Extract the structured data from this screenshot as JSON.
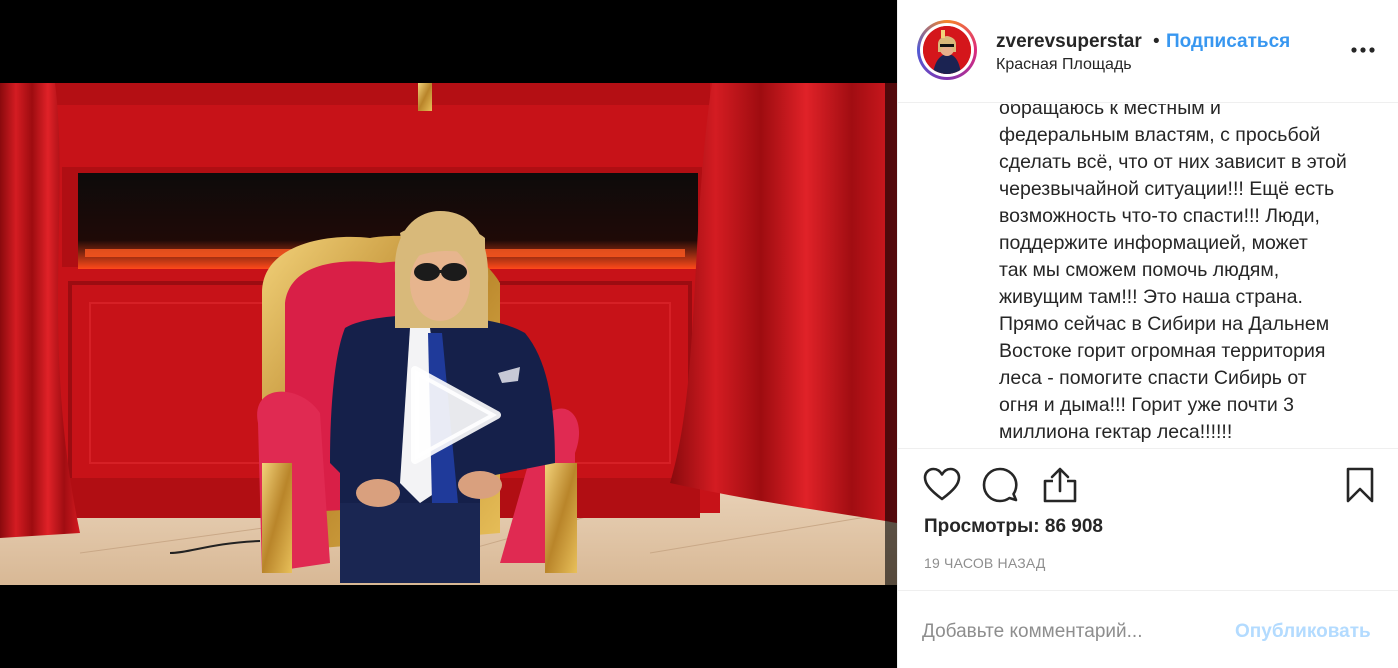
{
  "post": {
    "username": "zverevsuperstar",
    "separator": "•",
    "follow_label": "Подписаться",
    "location": "Красная Площадь",
    "caption": "обращаюсь к местным и\nфедеральным властям, с просьбой\nсделать всё, что от них зависит в этой\nчерезвычайной ситуации!!! Ещё есть\nвозможность что-то спасти!!! Люди,\nподдержите информацией, может\nтак мы сможем помочь людям,\nживущим там!!! Это наша страна.\nПрямо сейчас в Сибири на Дальнем\nВостоке горит огромная территория\nлеса - помогите спасти Сибирь от\nогня и дыма!!! Горит уже почти 3\nмиллиона гектар леса!!!!!!",
    "views_label": "Просмотры:",
    "views_count": "86 908",
    "timestamp": "19 ЧАСОВ НАЗАД"
  },
  "comment": {
    "placeholder": "Добавьте комментарий...",
    "publish_label": "Опубликовать"
  },
  "icons": {
    "like": "heart-icon",
    "comment": "speech-bubble-icon",
    "share": "share-icon",
    "save": "bookmark-icon",
    "more": "more-options-icon",
    "play": "play-icon"
  },
  "colors": {
    "accent": "#3897f0",
    "publish_disabled": "#b3dbff",
    "muted": "#8e8e8e",
    "text": "#262626"
  }
}
